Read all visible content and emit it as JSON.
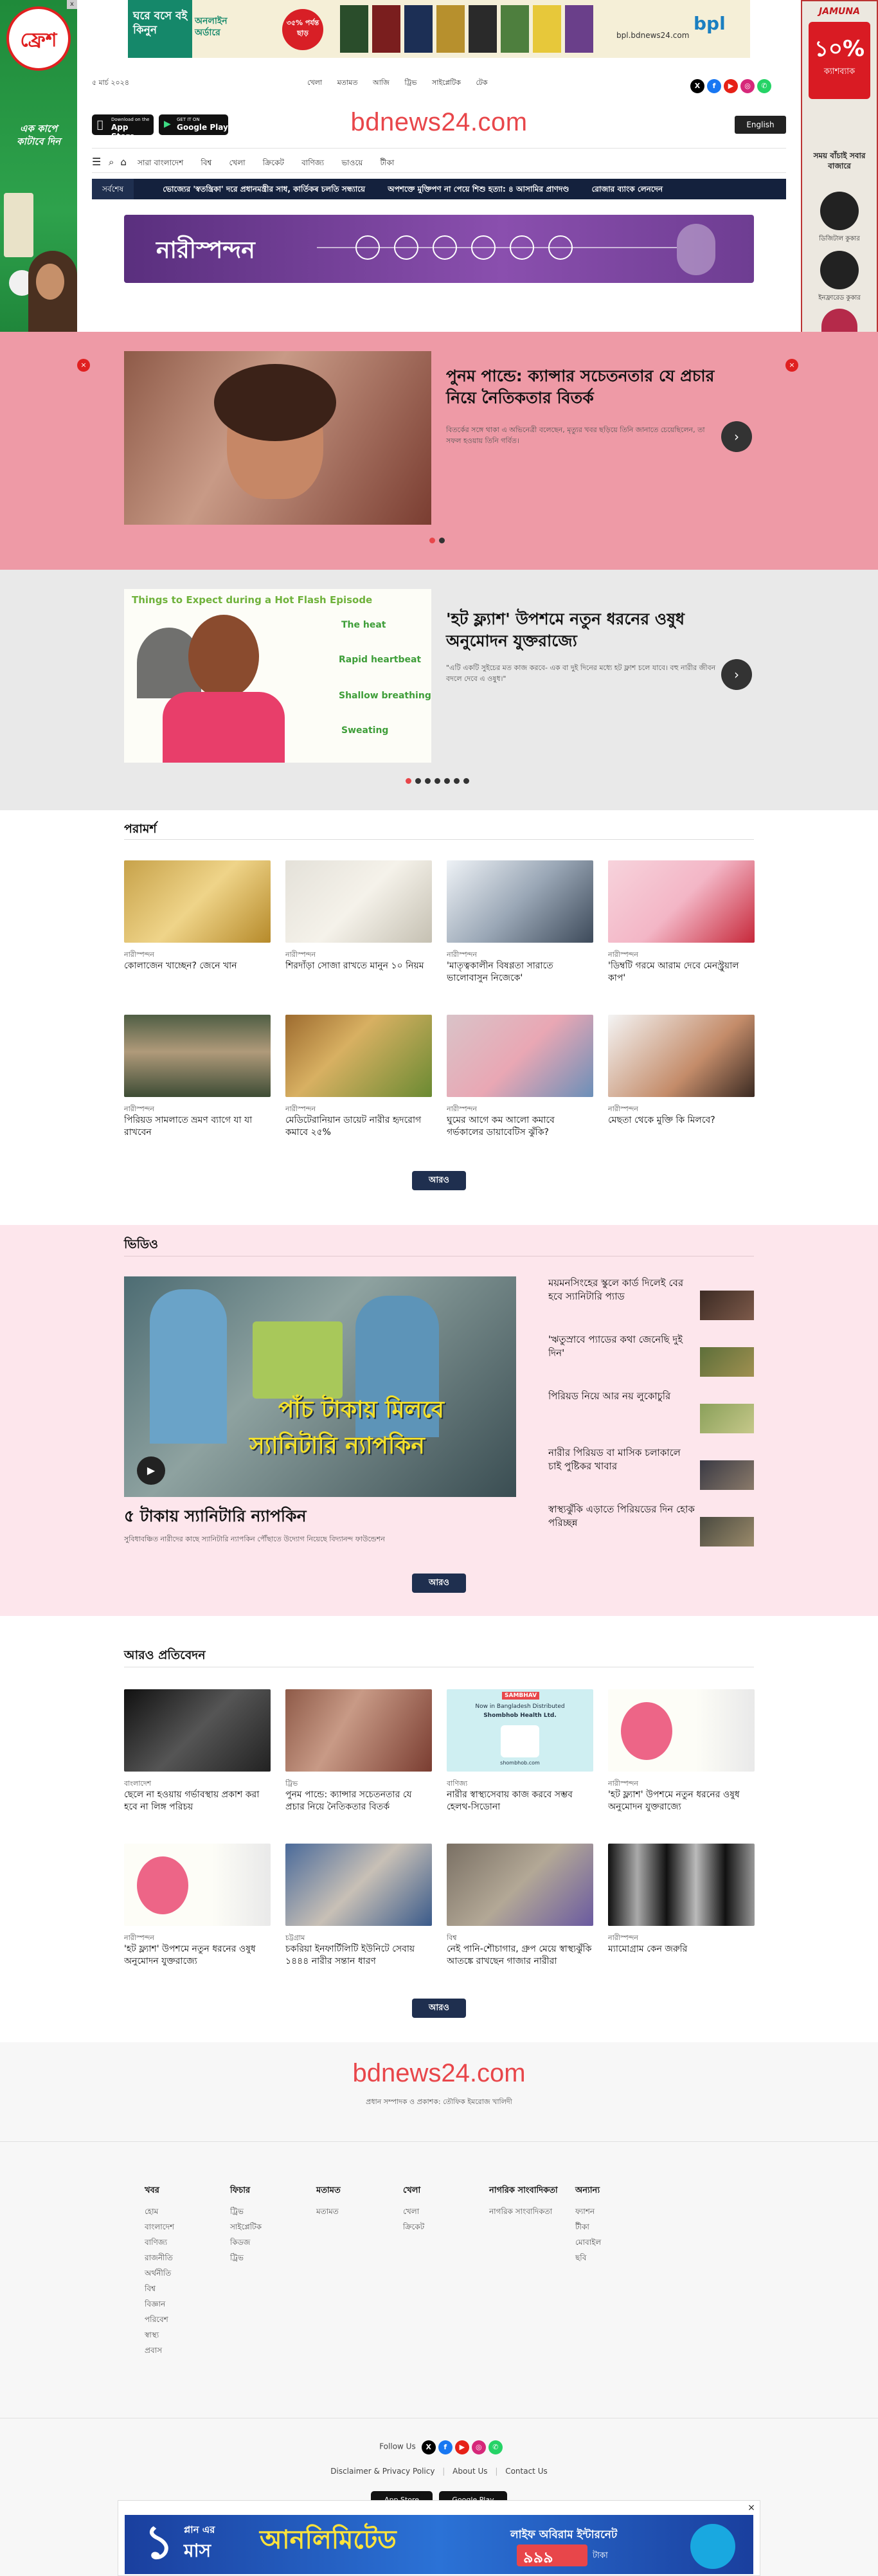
{
  "ads": {
    "top_banner_text": "ঘরে বসে বই কিনুন",
    "top_banner_sub": "অনলাইন অর্ডারে",
    "top_banner_badge": "৩৫% পর্যন্ত ছাড়",
    "top_banner_brand": "bpl",
    "top_banner_url": "bpl.bdnews24.com",
    "left_brand": "ফ্রেশ",
    "left_tagline": "এক কাপে কাটাবে দিন",
    "right_brand": "JAMUNA",
    "right_discount": "১০%",
    "right_discount_label": "ক্যাশব্যাক",
    "right_title": "সময় বাঁচাই সবার বাজারে",
    "right_item1": "ডিজিটাল কুকার",
    "right_item2": "ইনফ্রারেড কুকার",
    "bottom_a": "১",
    "bottom_b": "প্লান এর",
    "bottom_c": "মাস",
    "bottom_d": "আনলিমিটেড",
    "bottom_e": "লাইফ অবিরাম ইন্টারনেট",
    "bottom_price": "৯৯৯",
    "bottom_price_label": "টাকা"
  },
  "header": {
    "date": "৫ মার্চ ২০২৪",
    "links": [
      "খেলা",
      "মতামত",
      "আজি",
      "ট্রিভ",
      "সাইপ্লেটিক",
      "টেক"
    ],
    "logo": "bdnews24.com",
    "app_store": "App Store",
    "app_store_pre": "Download on the",
    "google_play": "Google Play",
    "google_play_pre": "GET IT ON",
    "english_button": "English",
    "nav": [
      "সারা বাংলাদেশ",
      "বিশ্ব",
      "খেলা",
      "ক্রিকেট",
      "বাণিজ্য",
      "ভাওয়ে",
      "টীকা"
    ],
    "ticker_label": "সর্বশেষ",
    "ticker_items": [
      "ভোজ্যের 'স্বতন্ত্রিকা' দরে প্রধানমন্ত্রীর সাধ, কার্তিকৰ চলতি সন্ধ্যায়ে",
      "অপশক্তে মুক্তিপণ না পেয়ে শিশু হত্যা: ৪ আসামির প্রাণদণ্ড",
      "রোজার ব্যাংক লেনদেন"
    ]
  },
  "section_banner": {
    "title": "নারীস্পন্দন"
  },
  "slider1": {
    "title": "পুনম পান্ডে: ক্যান্সার সচেতনতার যে প্রচার নিয়ে নৈতিকতার বিতর্ক",
    "summary": "বিতর্কের সঙ্গে থাকা এ অভিনেত্রী বলেছেন, মৃত্যুর খবর ছড়িয়ে তিনি জানাতে চেয়েছিলেন, তা সফল হওয়ায় তিনি গর্বিত।"
  },
  "slider2": {
    "title": "'হট ফ্ল্যাশ' উপশমে নতুন ধরনের ওষুধ অনুমোদন যুক্তরাজ্যে",
    "summary": "\"এটি একটি সুইচের মত কাজ করবে- এক বা দুই দিনের মধ্যে হট ফ্লাশ চলে যাবে। বহু নারীর জীবন বদলে দেবে এ ওষুধ।\"",
    "infographic_title": "Things to Expect during a Hot Flash Episode",
    "infographic_items": [
      "The heat",
      "Rapid heartbeat",
      "Shallow breathing",
      "Sweating"
    ]
  },
  "advice": {
    "heading": "পরামর্শ",
    "items": [
      {
        "cat": "নারীস্পন্দন",
        "title": "কোলাজেন খাচ্ছেন? জেনে খান"
      },
      {
        "cat": "নারীস্পন্দন",
        "title": "শিরদাঁড়া সোজা রাখতে মানুন ১০ নিয়ম"
      },
      {
        "cat": "নারীস্পন্দন",
        "title": "'মাতৃত্বকালীন বিষণ্ণতা সারাতে ভালোবাসুন নিজেকে'"
      },
      {
        "cat": "নারীস্পন্দন",
        "title": "'ডিম্বটি গরমে আরাম দেবে মেনস্ট্রুয়াল কাপ'"
      },
      {
        "cat": "নারীস্পন্দন",
        "title": "পিরিয়ড সামলাতে ভ্রমণ ব্যাগে যা যা রাখবেন"
      },
      {
        "cat": "নারীস্পন্দন",
        "title": "মেডিটেরানিয়ান ডায়েট নারীর হৃদরোগ কমাবে ২৫%"
      },
      {
        "cat": "নারীস্পন্দন",
        "title": "ঘুমের আগে কম আলো কমাবে গর্ভকালের ডায়াবেটিস ঝুঁকি?"
      },
      {
        "cat": "নারীস্পন্দন",
        "title": "মেছতা থেকে মুক্তি কি মিলবে?"
      }
    ],
    "more": "আরও"
  },
  "video": {
    "heading": "ভিডিও",
    "main_overlay_1": "পাঁচ টাকায় মিলবে",
    "main_overlay_2": "স্যানিটারি ন্যাপকিন",
    "main_title": "৫ টাকায় স্যানিটারি ন্যাপকিন",
    "main_summary": "সুবিধাবঞ্চিত নারীদের কাছে স্যানিটারি ন্যাপকিন পৌঁছাতে উদ্যোগ নিয়েছে বিদ্যানন্দ ফাউন্ডেশন",
    "list": [
      "ময়মনসিংহের স্কুলে কার্ড দিলেই বের হবে স্যানিটারি প্যাড",
      "'ঋতুস্রাবে প্যাডের কথা জেনেছি দুই দিন'",
      "পিরিয়ড নিয়ে আর নয় লুকোচুরি",
      "নারীর পিরিয়ড বা মাসিক চলাকালে চাই পুষ্টিকর খাবার",
      "স্বাস্থ্যঝুঁকি এড়াতে পিরিয়ডের দিন হোক পরিচ্ছন্ন"
    ],
    "more": "আরও"
  },
  "more_reports": {
    "heading": "আরও প্রতিবেদন",
    "items": [
      {
        "cat": "বাংলাদেশ",
        "title": "ছেলে না হওয়ায় গর্ভাবস্থায় প্রকাশ করা হবে না লিঙ্গ পরিচয়"
      },
      {
        "cat": "ট্রিভ",
        "title": "পুনম পান্ডে: ক্যান্সার সচেতনতার যে প্রচার নিয়ে নৈতিকতার বিতর্ক"
      },
      {
        "cat": "বাণিজ্য",
        "title": "নারীর স্বাস্থ্যসেবায় কাজ করবে সম্ভব হেলথ-সিডোনা"
      },
      {
        "cat": "নারীস্পন্দন",
        "title": "'হট ফ্ল্যাশ' উপশমে নতুন ধরনের ওষুধ অনুমোদন যুক্তরাজ্যে"
      },
      {
        "cat": "নারীস্পন্দন",
        "title": "'হট ফ্ল্যাশ' উপশমে নতুন ধরনের ওষুধ অনুমোদন যুক্তরাজ্যে"
      },
      {
        "cat": "চট্টগ্রাম",
        "title": "চকরিয়া ইনফার্টিলিটি ইউনিটে সেবায় ১৪৪৪ নারীর সন্তান ধারণ"
      },
      {
        "cat": "বিশ্ব",
        "title": "নেই পানি-শৌচাগার, গ্রুপ মেয়ে স্বাস্থ্যঝুঁকি আতঙ্কে রাখছেন গাজার নারীরা"
      },
      {
        "cat": "নারীস্পন্দন",
        "title": "ম্যামোগ্রাম কেন জরুরি"
      }
    ],
    "sambhav_a": "SAMBHAV",
    "sambhav_b": "Now in Bangladesh Distributed",
    "sambhav_c": "Shombhob Health Ltd.",
    "sambhav_d": "shombhob.com",
    "more": "আরও"
  },
  "footer": {
    "logo": "bdnews24.com",
    "credit": "প্রধান সম্পাদক ও প্রকাশক: তৌফিক ইমরোজ খালিদী",
    "columns": [
      {
        "title": "খবর",
        "links": [
          "হোম",
          "বাংলাদেশ",
          "বাণিজ্য",
          "রাজনীতি",
          "অর্থনীতি",
          "বিশ্ব",
          "বিজ্ঞান",
          "পরিবেশ",
          "স্বাস্থ্য",
          "প্রবাস"
        ]
      },
      {
        "title": "ফিচার",
        "links": [
          "ট্রিভ",
          "সাইপ্লেটিক",
          "কিডজ",
          "ট্রিভ"
        ]
      },
      {
        "title": "মতামত",
        "links": [
          "মতামত"
        ]
      },
      {
        "title": "খেলা",
        "links": [
          "খেলা",
          "ক্রিকেট"
        ]
      },
      {
        "title": "নাগরিক সাংবাদিকতা",
        "links": [
          "নাগরিক সাংবাদিকতা"
        ]
      },
      {
        "title": "অন্যান্য",
        "links": [
          "ফ্যাশন",
          "টীকা",
          "মোবাইল",
          "ছবি"
        ]
      }
    ],
    "follow": "Follow Us",
    "links": [
      "Disclaimer & Privacy Policy",
      "About Us",
      "Contact Us"
    ],
    "app_store": "App Store",
    "google_play": "Google Play"
  },
  "colors": {
    "brand": "#e8464a",
    "navy": "#1f2f4f",
    "ticker": "#14213d",
    "purple": "#6b3f8e",
    "pink_section": "#fde6ec",
    "slider_pink": "#ee9aa6"
  },
  "icons": [
    "search-icon",
    "home-icon",
    "menu-icon",
    "play-icon",
    "close-icon",
    "x-icon",
    "facebook-icon",
    "youtube-icon",
    "instagram-icon",
    "whatsapp-icon",
    "arrow-right-icon"
  ]
}
